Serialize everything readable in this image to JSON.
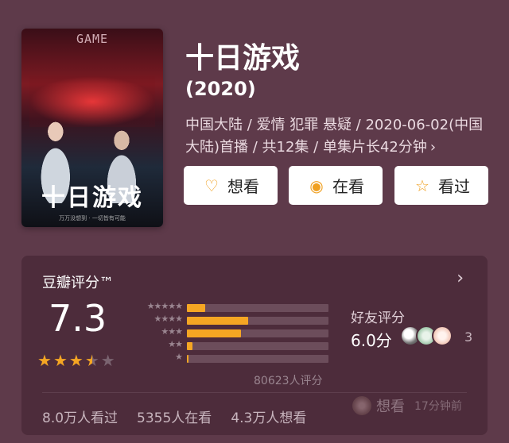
{
  "poster": {
    "en_title": "GAME",
    "cn_logo": "十日游戏",
    "caption": "万万没想到 · 一切皆有可能"
  },
  "show": {
    "title": "十日游戏",
    "year": "(2020)",
    "meta_line": "中国大陆 / 爱情 犯罪 悬疑 / 2020-06-02(中国大陆)首播 / 共12集 / 单集片长42分钟",
    "meta_chevron": "›"
  },
  "actions": [
    {
      "label": "想看",
      "icon": "heart-plus-icon",
      "glyph": "♡"
    },
    {
      "label": "在看",
      "icon": "target-circle-icon",
      "glyph": "◉"
    },
    {
      "label": "看过",
      "icon": "star-outline-icon",
      "glyph": "☆"
    }
  ],
  "rating": {
    "title": "豆瓣评分™",
    "chevron": "›",
    "score": "7.3",
    "stars": {
      "value": 3.5,
      "max": 5
    },
    "distribution": [
      {
        "stars": "★★★★★",
        "fraction": 0.13
      },
      {
        "stars": "★★★★",
        "fraction": 0.43
      },
      {
        "stars": "★★★",
        "fraction": 0.38
      },
      {
        "stars": "★★",
        "fraction": 0.04
      },
      {
        "stars": "★",
        "fraction": 0.01
      }
    ],
    "count_text": "80623人评分",
    "friends": {
      "label": "好友评分",
      "score": "6.0分",
      "count": "3"
    },
    "stats": [
      "8.0万人看过",
      "5355人在看",
      "4.3万人想看"
    ],
    "feed": {
      "action": "想看",
      "time": "17分钟前"
    }
  },
  "colors": {
    "background": "#5e3a4a",
    "card": "#4d2c3b",
    "accent": "#f5a623"
  }
}
